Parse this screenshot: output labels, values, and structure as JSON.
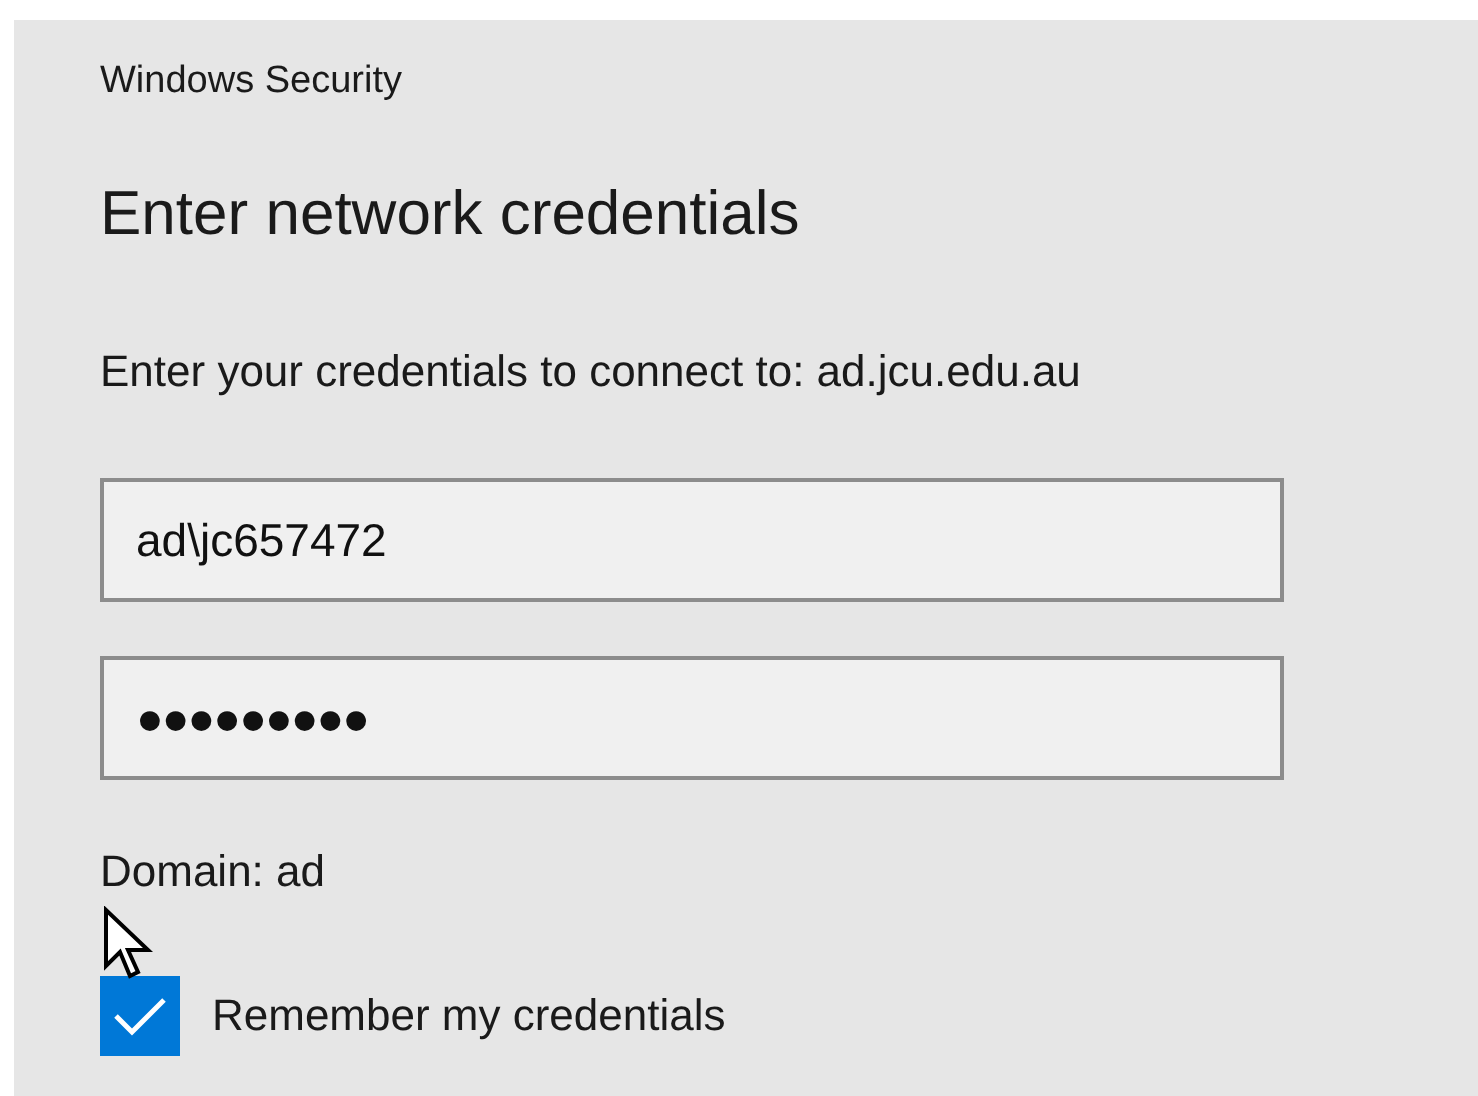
{
  "window": {
    "title": "Windows Security"
  },
  "heading": "Enter network credentials",
  "description": "Enter your credentials to connect to: ad.jcu.edu.au",
  "fields": [
    {
      "kind": "username",
      "value": "ad\\jc657472"
    },
    {
      "kind": "password",
      "value": "●●●●●●●●●"
    }
  ],
  "domain": "Domain: ad",
  "remember": {
    "label": "Remember my credentials",
    "checked": true
  }
}
